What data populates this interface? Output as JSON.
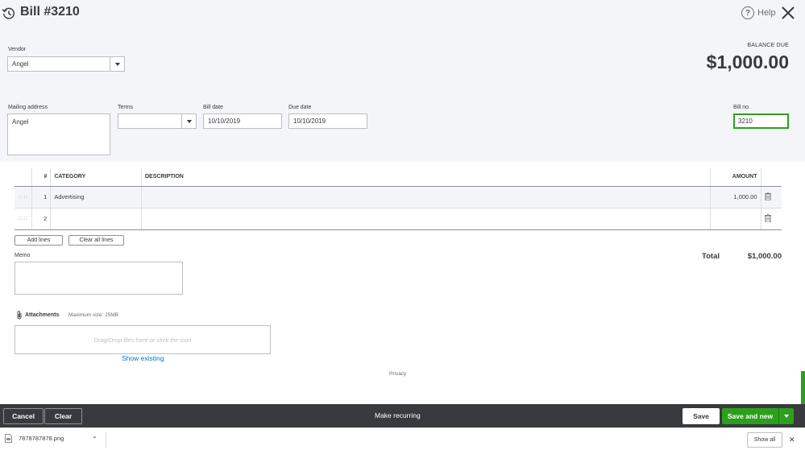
{
  "header": {
    "title": "Bill #3210",
    "help_label": "Help",
    "balance_label": "BALANCE DUE",
    "balance_amount": "$1,000.00"
  },
  "form": {
    "vendor_label": "Vendor",
    "vendor_value": "Angel",
    "mailing_label": "Mailing address",
    "mailing_value": "Angel",
    "terms_label": "Terms",
    "terms_value": "",
    "bill_date_label": "Bill date",
    "bill_date_value": "10/10/2019",
    "due_date_label": "Due date",
    "due_date_value": "10/10/2019",
    "bill_no_label": "Bill no.",
    "bill_no_value": "3210"
  },
  "table": {
    "headers": [
      "#",
      "CATEGORY",
      "DESCRIPTION",
      "AMOUNT"
    ],
    "rows": [
      {
        "num": "1",
        "category": "Advertising",
        "description": "",
        "amount": "1,000.00"
      },
      {
        "num": "2",
        "category": "",
        "description": "",
        "amount": ""
      }
    ]
  },
  "actions": {
    "add_lines": "Add lines",
    "clear_all_lines": "Clear all lines"
  },
  "memo": {
    "label": "Memo",
    "value": ""
  },
  "totals": {
    "label": "Total",
    "amount": "$1,000.00"
  },
  "attachments": {
    "label": "Attachments",
    "max_size": "Maximum size: 25MB",
    "dropzone": "Drag/Drop files here or click the icon",
    "show_existing": "Show existing"
  },
  "privacy": "Privacy",
  "footer": {
    "cancel": "Cancel",
    "clear": "Clear",
    "make_recurring": "Make recurring",
    "save": "Save",
    "save_and_new": "Save and new"
  },
  "downloads": {
    "file_name": "7878787878.png",
    "show_all": "Show all"
  },
  "colors": {
    "accent_green": "#2ca01c",
    "footer_bg": "#393a3d",
    "link_blue": "#0077c5"
  }
}
